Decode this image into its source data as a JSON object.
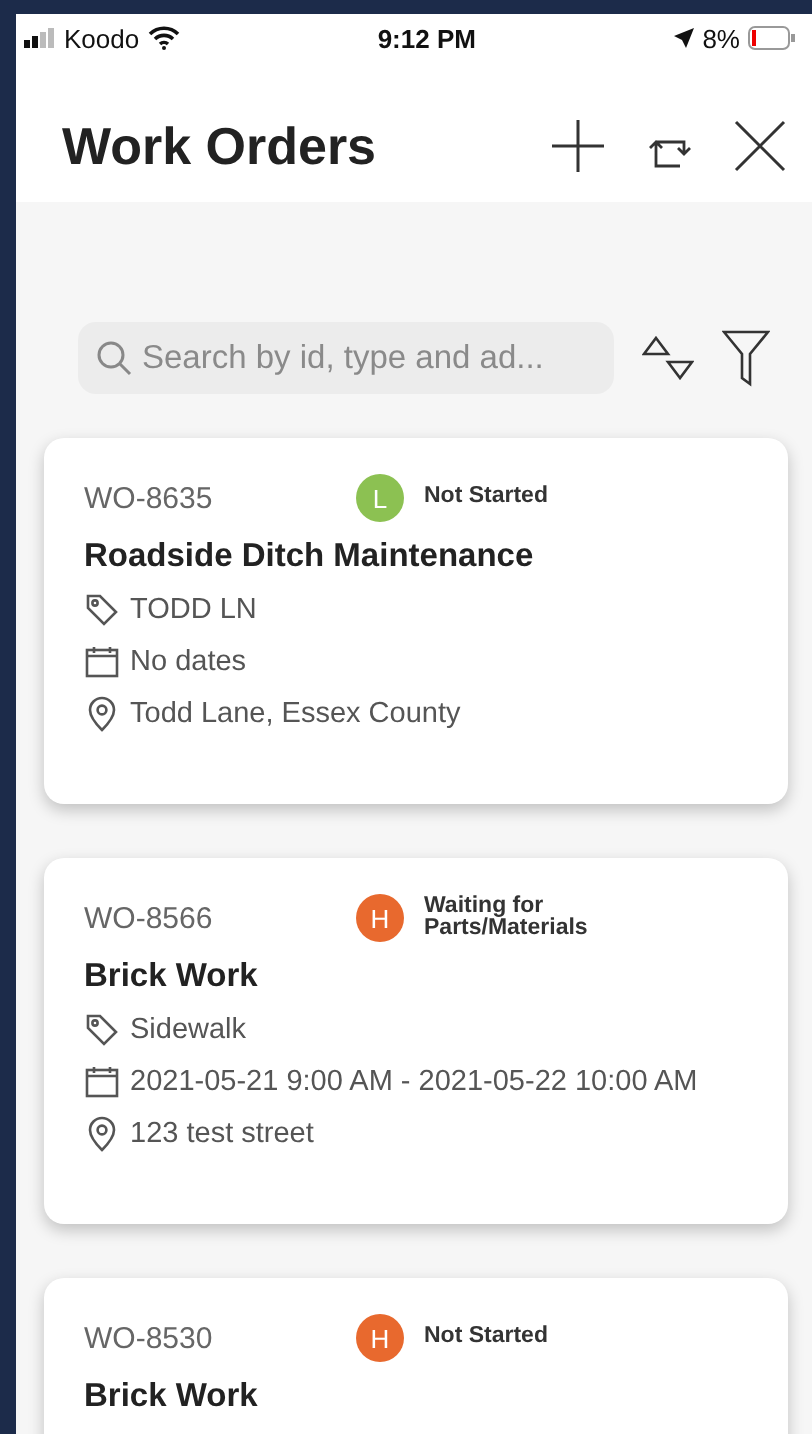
{
  "status_bar": {
    "carrier": "Koodo",
    "time": "9:12 PM",
    "battery": "8%"
  },
  "header": {
    "title": "Work Orders"
  },
  "search": {
    "placeholder": "Search by id, type and ad..."
  },
  "work_orders": [
    {
      "id": "WO-8635",
      "priority": "L",
      "color": "#8cc152",
      "status": "Not Started",
      "title": "Roadside Ditch Maintenance",
      "details": [
        {
          "kind": "tag",
          "text": "TODD LN"
        },
        {
          "kind": "date",
          "text": "No dates"
        },
        {
          "kind": "location",
          "text": "Todd Lane, Essex County"
        }
      ]
    },
    {
      "id": "WO-8566",
      "priority": "H",
      "color": "#e8692e",
      "status": "Waiting for Parts/Materials",
      "title": "Brick Work",
      "details": [
        {
          "kind": "tag",
          "text": "Sidewalk"
        },
        {
          "kind": "date",
          "text": "2021-05-21 9:00 AM - 2021-05-22 10:00 AM"
        },
        {
          "kind": "location",
          "text": "123 test street"
        }
      ]
    },
    {
      "id": "WO-8530",
      "priority": "H",
      "color": "#e8692e",
      "status": "Not Started",
      "title": "Brick Work"
    }
  ]
}
